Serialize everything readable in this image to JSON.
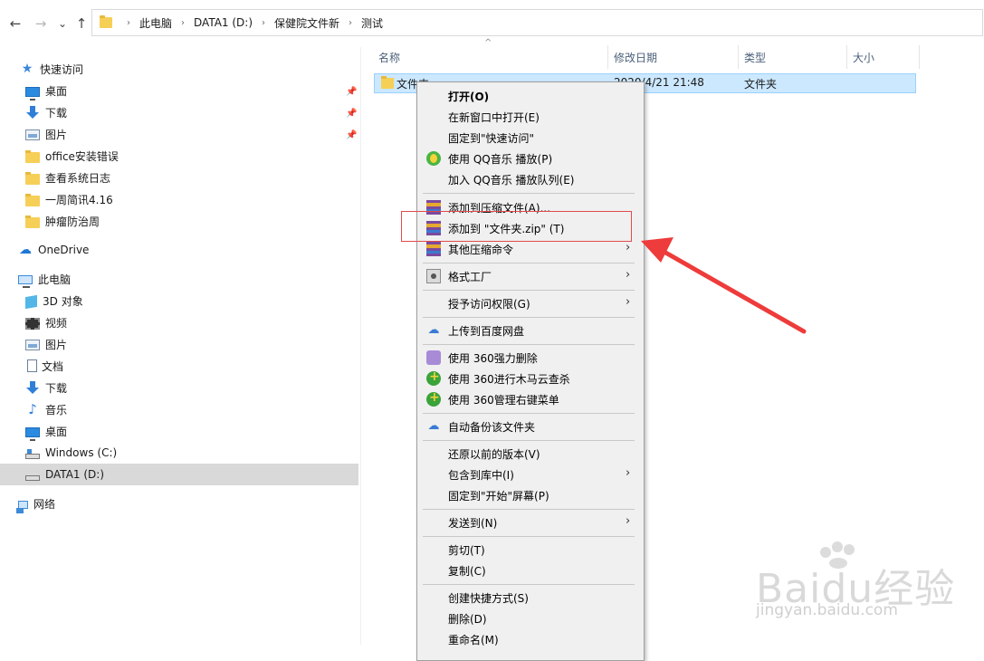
{
  "nav": {
    "back": "←",
    "forward": "→",
    "recent": "⌄",
    "up": "↑"
  },
  "address": {
    "crumbs": [
      "此电脑",
      "DATA1 (D:)",
      "保健院文件新",
      "测试"
    ],
    "separator": "›"
  },
  "sidebar": {
    "quick_access": "快速访问",
    "quick_items": [
      "桌面",
      "下载",
      "图片",
      "office安装错误",
      "查看系统日志",
      "一周简讯4.16",
      "肿瘤防治周"
    ],
    "onedrive": "OneDrive",
    "this_pc": "此电脑",
    "pc_items": [
      "3D 对象",
      "视频",
      "图片",
      "文档",
      "下载",
      "音乐",
      "桌面",
      "Windows (C:)",
      "DATA1 (D:)"
    ],
    "network": "网络",
    "selected": "DATA1 (D:)"
  },
  "columns": {
    "name": "名称",
    "modified": "修改日期",
    "type": "类型",
    "size": "大小"
  },
  "file_row": {
    "name": "文件夹",
    "modified": "2020/4/21 21:48",
    "type": "文件夹"
  },
  "context_menu": {
    "open": "打开(O)",
    "open_new_window": "在新窗口中打开(E)",
    "pin_quick": "固定到\"快速访问\"",
    "qq_play": "使用 QQ音乐 播放(P)",
    "qq_queue": "加入 QQ音乐 播放队列(E)",
    "add_archive": "添加到压缩文件(A)...",
    "add_zip": "添加到 \"文件夹.zip\" (T)",
    "other_compress": "其他压缩命令",
    "format_factory": "格式工厂",
    "grant_access": "授予访问权限(G)",
    "upload_baidu": "上传到百度网盘",
    "del_360": "使用 360强力删除",
    "scan_360": "使用 360进行木马云查杀",
    "manage_360": "使用 360管理右键菜单",
    "auto_backup": "自动备份该文件夹",
    "restore": "还原以前的版本(V)",
    "include_library": "包含到库中(I)",
    "pin_start": "固定到\"开始\"屏幕(P)",
    "send_to": "发送到(N)",
    "cut": "剪切(T)",
    "copy": "复制(C)",
    "create_shortcut": "创建快捷方式(S)",
    "delete": "删除(D)",
    "rename": "重命名(M)"
  },
  "watermark": {
    "brand": "Baidu经验",
    "url": "jingyan.baidu.com"
  },
  "colors": {
    "selection": "#cce8ff",
    "highlight_box": "#e34a4a",
    "arrow": "#ee3b3b"
  }
}
